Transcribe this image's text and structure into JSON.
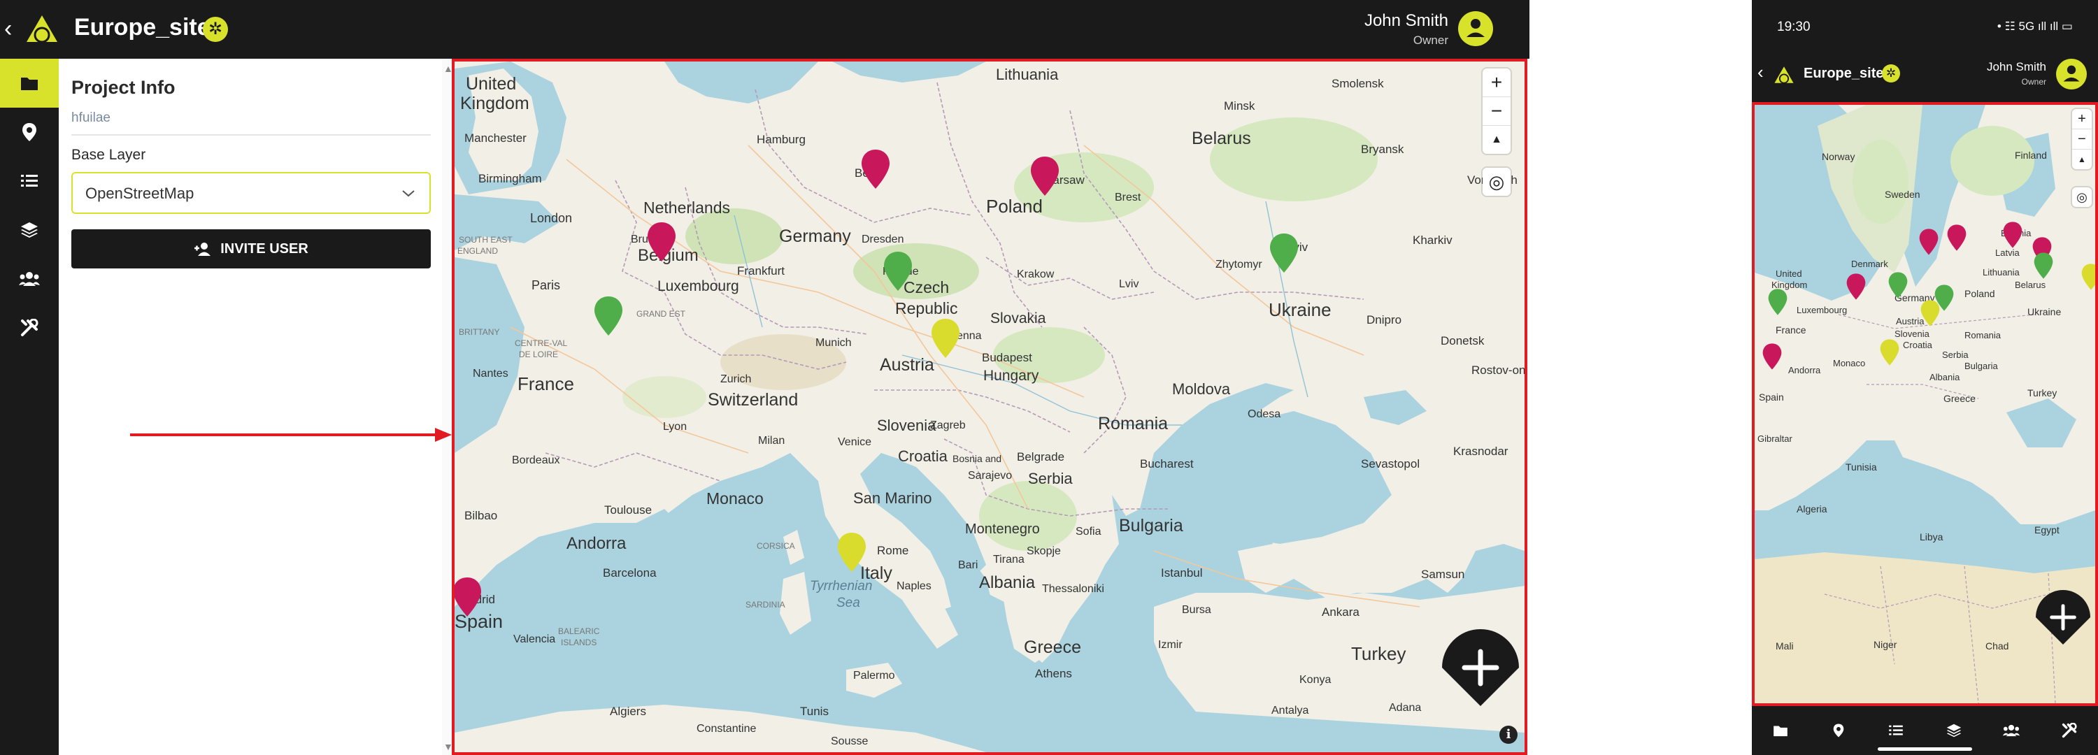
{
  "desktop": {
    "header": {
      "title": "Europe_sites",
      "user_name": "John Smith",
      "user_role": "Owner"
    },
    "sidebar": {
      "items": [
        {
          "icon": "folder-icon",
          "active": true
        },
        {
          "icon": "map-pin-icon",
          "active": false
        },
        {
          "icon": "task-list-icon",
          "active": false
        },
        {
          "icon": "layers-icon",
          "active": false
        },
        {
          "icon": "users-icon",
          "active": false
        },
        {
          "icon": "tools-icon",
          "active": false
        }
      ]
    },
    "panel": {
      "title": "Project Info",
      "subtitle": "hfuilae",
      "base_layer_label": "Base Layer",
      "base_layer_value": "OpenStreetMap",
      "invite_label": "INVITE USER"
    },
    "map": {
      "controls": {
        "zoom_in": "+",
        "zoom_out": "−",
        "compass": "▲",
        "locate": "◎",
        "info": "i"
      },
      "labels": {
        "lithuania": "Lithuania",
        "united_kingdom_1": "United",
        "united_kingdom_2": "Kingdom",
        "manchester": "Manchester",
        "birmingham": "Birmingham",
        "london": "London",
        "south_east_england": "SOUTH EAST",
        "south_east_england_2": "ENGLAND",
        "hamburg": "Hamburg",
        "berlin": "Berlin",
        "netherlands": "Netherlands",
        "belgium": "Belgium",
        "brussels": "Brussels",
        "luxembourg": "Luxembourg",
        "germany": "Germany",
        "frankfurt": "Frankfurt",
        "dresden": "Dresden",
        "prague": "Prague",
        "czech_1": "Czech",
        "czech_2": "Republic",
        "poland": "Poland",
        "warsaw": "Warsaw",
        "brest": "Brest",
        "krakow": "Krakow",
        "lviv": "Lviv",
        "belarus": "Belarus",
        "minsk": "Minsk",
        "smolensk": "Smolensk",
        "bryansk": "Bryansk",
        "voronezh": "Voronezh",
        "zhytomyr": "Zhytomyr",
        "kyiv": "Kyiv",
        "kharkiv": "Kharkiv",
        "ukraine": "Ukraine",
        "dnipro": "Dnipro",
        "donetsk": "Donetsk",
        "rostov": "Rostov-on-D",
        "paris": "Paris",
        "grand_est": "GRAND EST",
        "brittany": "BRITTANY",
        "centre": "CENTRE-VAL",
        "centre_2": "DE LOIRE",
        "france": "France",
        "nantes": "Nantes",
        "lyon": "Lyon",
        "bordeaux": "Bordeaux",
        "munich": "Munich",
        "austria": "Austria",
        "vienna": "Vienna",
        "slovakia": "Slovakia",
        "budapest": "Budapest",
        "hungary": "Hungary",
        "switzerland": "Switzerland",
        "zurich": "Zurich",
        "milan": "Milan",
        "venice": "Venice",
        "slovenia": "Slovenia",
        "croatia": "Croatia",
        "zagreb": "Zagreb",
        "moldova": "Moldova",
        "odesa": "Odesa",
        "romania": "Romania",
        "bucharest": "Bucharest",
        "belgrade": "Belgrade",
        "serbia": "Serbia",
        "sarajevo": "Sarajevo",
        "bosnia": "Bosnia and",
        "monaco": "Monaco",
        "san_marino": "San Marino",
        "rome": "Rome",
        "italy": "Italy",
        "montenegro": "Montenegro",
        "bulgaria": "Bulgaria",
        "sofia": "Sofia",
        "sevastopol": "Sevastopol",
        "krasnodar": "Krasnodar",
        "andorra": "Andorra",
        "toulouse": "Toulouse",
        "bilbao": "Bilbao",
        "barcelona": "Barcelona",
        "madrid": "Madrid",
        "spain": "Spain",
        "valencia": "Valencia",
        "balearic": "BALEARIC",
        "balearic_2": "ISLANDS",
        "corsica": "CORSICA",
        "sardinia": "SARDINIA",
        "tyrrhenian": "Tyrrhenian",
        "sea": "Sea",
        "naples": "Naples",
        "bari": "Bari",
        "albania": "Albania",
        "tirana": "Tirana",
        "skopje": "Skopje",
        "thessaloniki": "Thessaloniki",
        "greece": "Greece",
        "athens": "Athens",
        "istanbul": "Istanbul",
        "bursa": "Bursa",
        "izmir": "Izmir",
        "ankara": "Ankara",
        "turkey": "Turkey",
        "samsun": "Samsun",
        "konya": "Konya",
        "antalya": "Antalya",
        "adana": "Adana",
        "palermo": "Palermo",
        "algiers": "Algiers",
        "tunis": "Tunis",
        "constantine": "Constantine",
        "sousse": "Sousse"
      },
      "markers": [
        {
          "color": "#c9175c"
        },
        {
          "color": "#c9175c"
        },
        {
          "color": "#c9175c"
        },
        {
          "color": "#4fae4a"
        },
        {
          "color": "#4fae4a"
        },
        {
          "color": "#4fae4a"
        },
        {
          "color": "#d9dc2c"
        },
        {
          "color": "#d9dc2c"
        },
        {
          "color": "#c9175c"
        }
      ]
    }
  },
  "phone": {
    "status": {
      "time": "19:30",
      "indicators": "• ☷ 5G ıll ıll ▭"
    },
    "header": {
      "title": "Europe_sites",
      "user_name": "John Smith",
      "user_role": "Owner"
    },
    "map": {
      "labels": {
        "norway": "Norway",
        "finland": "Finland",
        "sweden": "Sweden",
        "estonia": "Estonia",
        "latvia": "Latvia",
        "lithuania": "Lithuania",
        "denmark": "Denmark",
        "belarus": "Belarus",
        "united_1": "United",
        "united_2": "Kingdom",
        "poland": "Poland",
        "germany": "Germany",
        "luxembourg": "Luxembourg",
        "ukraine": "Ukraine",
        "austria": "Austria",
        "slovenia": "Slovenia",
        "croatia": "Croatia",
        "romania": "Romania",
        "france": "France",
        "serbia": "Serbia",
        "bulgaria": "Bulgaria",
        "monaco": "Monaco",
        "albania": "Albania",
        "andorra": "Andorra",
        "spain": "Spain",
        "greece": "Greece",
        "turkey": "Turkey",
        "gibraltar": "Gibraltar",
        "tunisia": "Tunisia",
        "algeria": "Algeria",
        "libya": "Libya",
        "egypt": "Egypt",
        "mali": "Mali",
        "niger": "Niger",
        "chad": "Chad"
      }
    }
  }
}
